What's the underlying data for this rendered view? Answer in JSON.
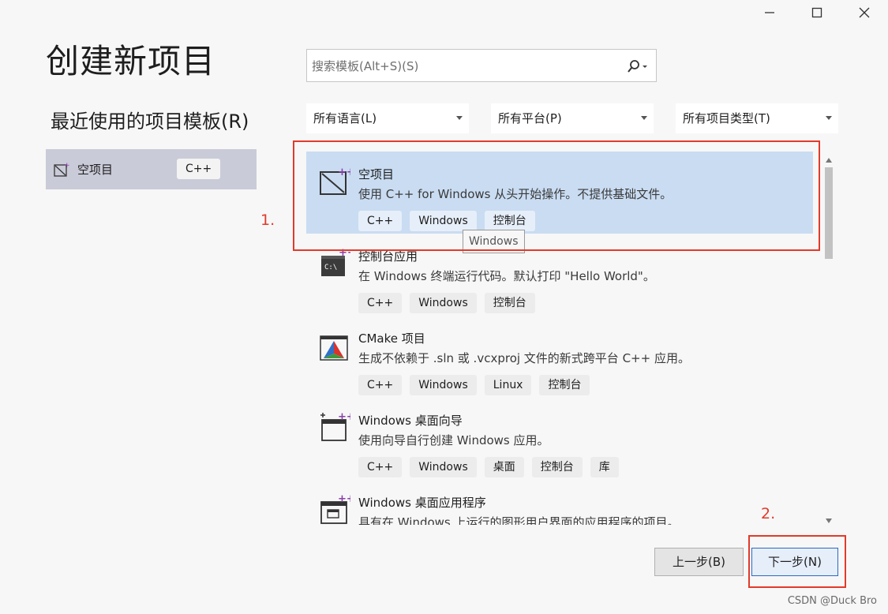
{
  "window": {
    "title": "创建新项目"
  },
  "recent": {
    "title": "最近使用的项目模板(R)",
    "items": [
      {
        "name": "空项目",
        "tag": "C++"
      }
    ]
  },
  "search": {
    "placeholder": "搜索模板(Alt+S)(S)"
  },
  "filters": [
    {
      "label": "所有语言(L)"
    },
    {
      "label": "所有平台(P)"
    },
    {
      "label": "所有项目类型(T)"
    }
  ],
  "templates": [
    {
      "title": "空项目",
      "desc": "使用 C++ for Windows 从头开始操作。不提供基础文件。",
      "tags": [
        "C++",
        "Windows",
        "控制台"
      ],
      "icon": "empty-project-icon",
      "selected": true
    },
    {
      "title": "控制台应用",
      "desc": "在 Windows 终端运行代码。默认打印 \"Hello World\"。",
      "tags": [
        "C++",
        "Windows",
        "控制台"
      ],
      "icon": "console-app-icon"
    },
    {
      "title": "CMake 项目",
      "desc": "生成不依赖于 .sln 或 .vcxproj 文件的新式跨平台 C++ 应用。",
      "tags": [
        "C++",
        "Windows",
        "Linux",
        "控制台"
      ],
      "icon": "cmake-icon"
    },
    {
      "title": "Windows 桌面向导",
      "desc": "使用向导自行创建 Windows 应用。",
      "tags": [
        "C++",
        "Windows",
        "桌面",
        "控制台",
        "库"
      ],
      "icon": "desktop-wizard-icon"
    },
    {
      "title": "Windows 桌面应用程序",
      "desc": "具有在 Windows 上运行的图形用户界面的应用程序的项目。",
      "tags": [],
      "icon": "desktop-app-icon"
    }
  ],
  "tooltip": "Windows",
  "annotations": {
    "first": "1.",
    "second": "2."
  },
  "buttons": {
    "back": "上一步(B)",
    "next": "下一步(N)"
  },
  "watermark": "CSDN @Duck Bro",
  "colors": {
    "selected_bg": "#c9dcf2",
    "annotation_red": "#e23a2a",
    "primary_border": "#2a6bc4"
  }
}
